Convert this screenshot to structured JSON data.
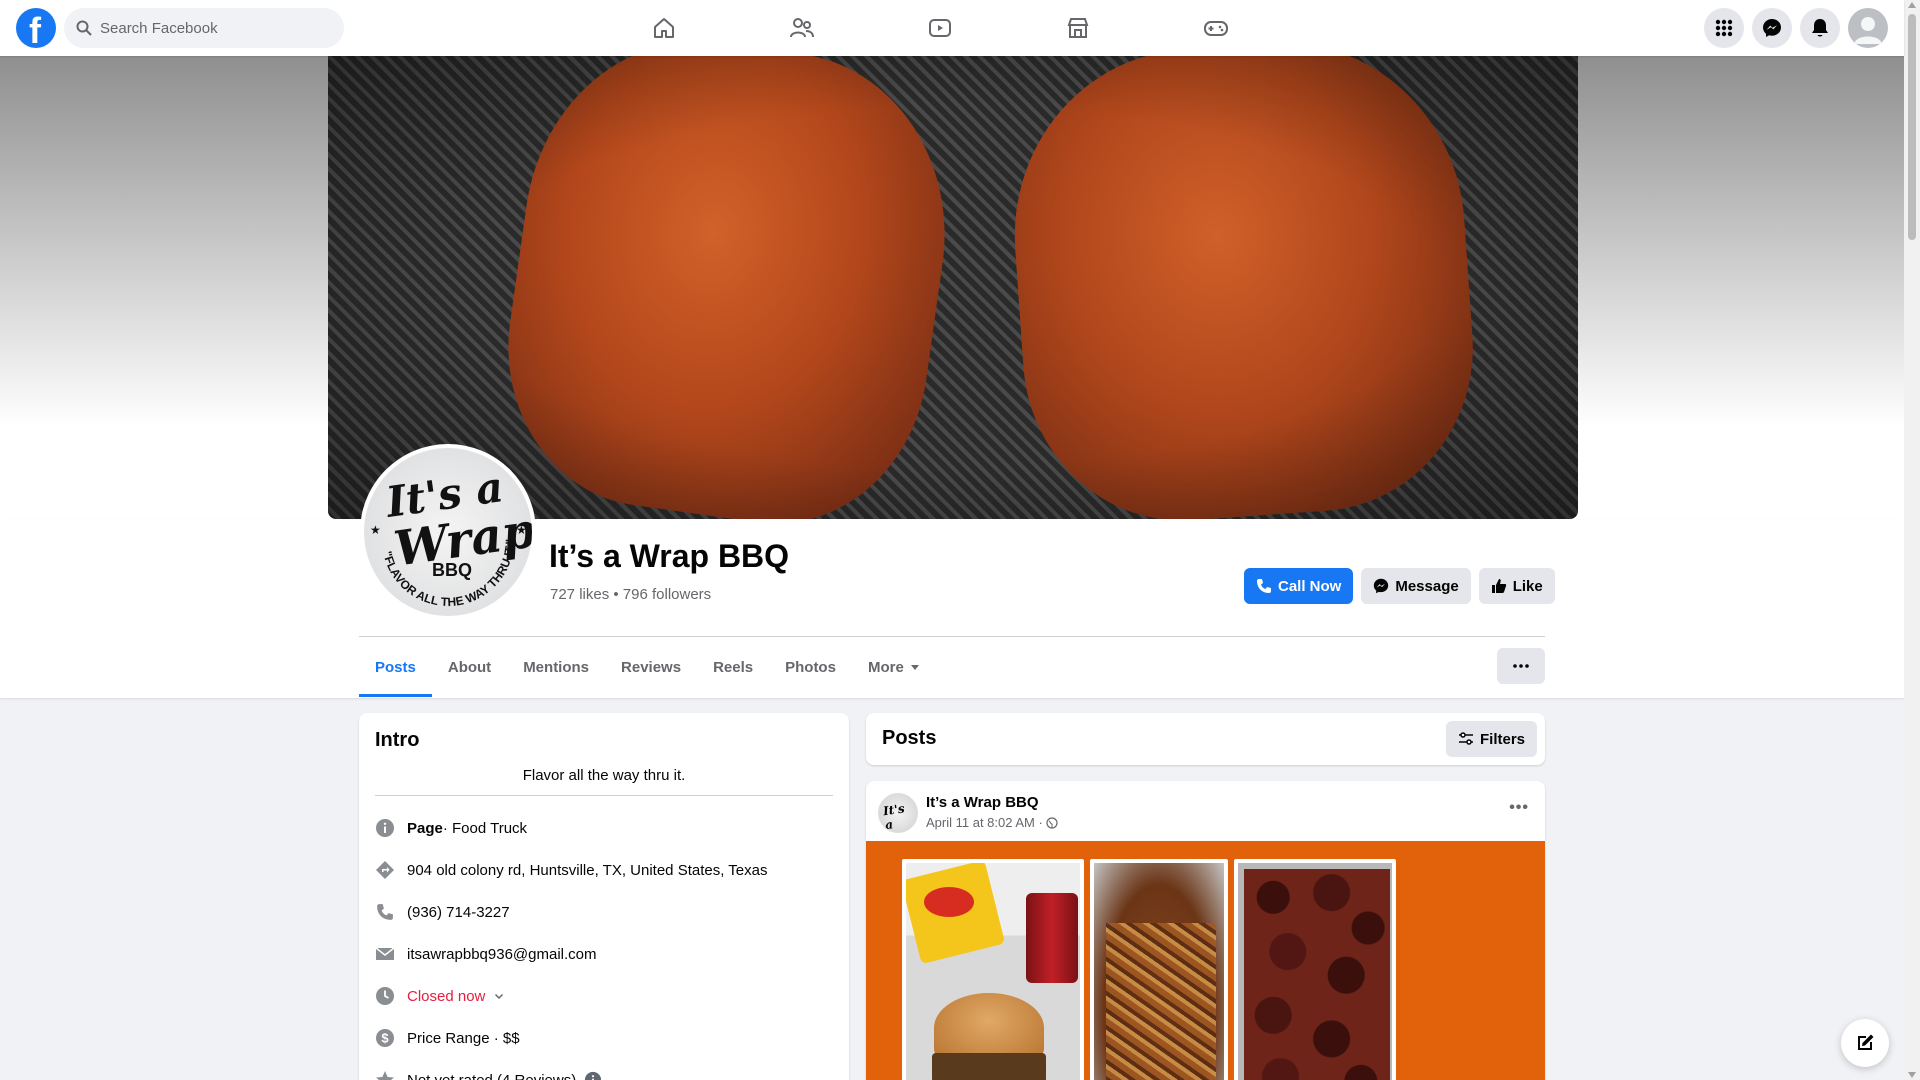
{
  "search": {
    "placeholder": "Search Facebook"
  },
  "nav": {
    "icons": [
      "home-icon",
      "friends-icon",
      "watch-icon",
      "marketplace-icon",
      "gaming-icon"
    ],
    "right": [
      "menu-grid-icon",
      "messenger-icon",
      "notifications-icon",
      "account-icon"
    ]
  },
  "page": {
    "name": "It’s a Wrap BBQ",
    "stats": "727 likes • 796 followers",
    "logo": {
      "its": "It's a",
      "wrap": "Wrap",
      "bbq": "BBQ",
      "tagline": "\"FLAVOR ALL THE WAY THRU IT.\""
    }
  },
  "actions": {
    "call": "Call Now",
    "message": "Message",
    "like": "Like"
  },
  "tabs": [
    {
      "label": "Posts",
      "active": true
    },
    {
      "label": "About"
    },
    {
      "label": "Mentions"
    },
    {
      "label": "Reviews"
    },
    {
      "label": "Reels"
    },
    {
      "label": "Photos"
    },
    {
      "label": "More"
    }
  ],
  "intro": {
    "title": "Intro",
    "bio": "Flavor all the way thru it.",
    "page_label": "Page",
    "category": " · Food Truck",
    "address": "904 old colony rd, Huntsville, TX, United States, Texas",
    "phone": "(936) 714-3227",
    "email": "itsawrapbbq936@gmail.com",
    "hours": "Closed now",
    "price": "Price Range · $$",
    "rating": "Not yet rated (4 Reviews)"
  },
  "posts": {
    "title": "Posts",
    "filters": "Filters",
    "post": {
      "author": "It’s a Wrap BBQ",
      "time": "April 11 at 8:02 AM ·"
    }
  },
  "colors": {
    "accent": "#1877f2",
    "closed": "#e41e3f",
    "post_bg": "#e2620b"
  }
}
